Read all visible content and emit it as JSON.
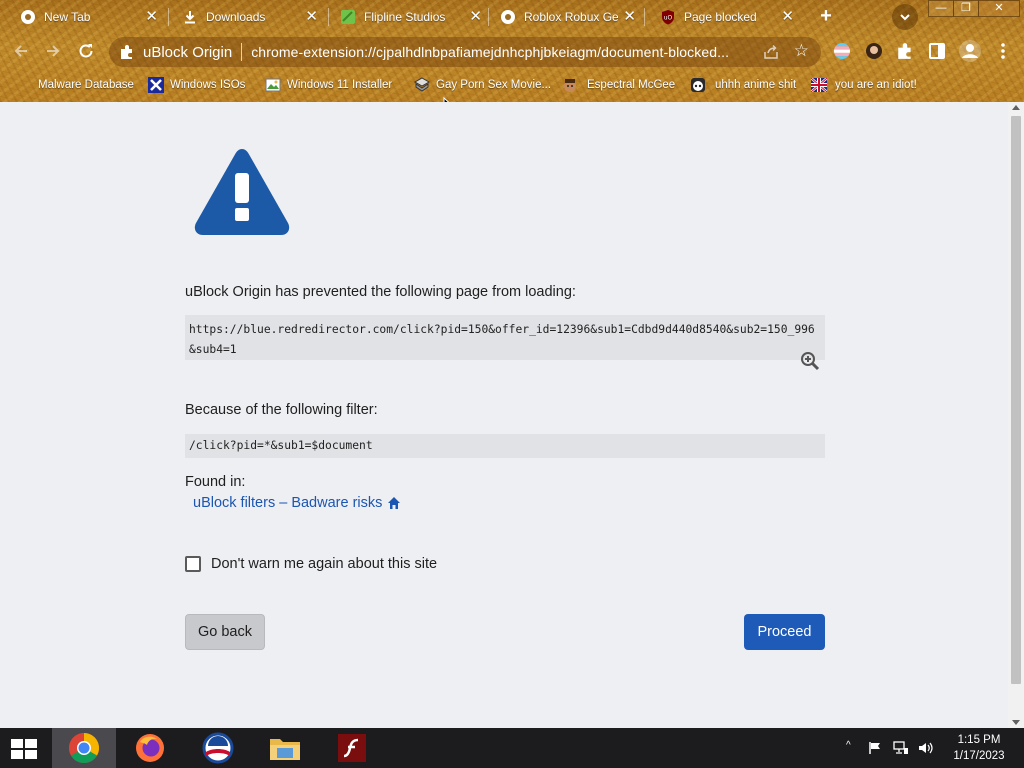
{
  "tabs": [
    {
      "title": "New Tab",
      "favicon": "chrome-icon",
      "close": "✕"
    },
    {
      "title": "Downloads",
      "favicon": "download-icon",
      "close": "✕"
    },
    {
      "title": "Flipline Studios - F",
      "favicon": "flipline-icon",
      "close": "✕"
    },
    {
      "title": "Roblox Robux Gen",
      "favicon": "chrome-icon",
      "close": "✕"
    },
    {
      "title": "Page blocked",
      "favicon": "ublock-icon",
      "close": "✕"
    }
  ],
  "window_controls": {
    "minimize": "—",
    "maximize": "❐",
    "close": "✕"
  },
  "toolbar": {
    "origin_label": "uBlock Origin",
    "url": "chrome-extension://cjpalhdlnbpafiamejdnhcphjbkeiagm/document-blocked..."
  },
  "bookmarks": [
    {
      "label": "Malware Database",
      "icon": "folder-icon"
    },
    {
      "label": "Windows ISOs",
      "icon": "x-icon"
    },
    {
      "label": "Windows 11 Installer",
      "icon": "image-icon"
    },
    {
      "label": "Gay Porn Sex Movie...",
      "icon": "bookmark-icon"
    },
    {
      "label": "Espectral McGee",
      "icon": "avatar-icon"
    },
    {
      "label": "uhhh anime shit",
      "icon": "anime-icon"
    },
    {
      "label": "you are an idiot!",
      "icon": "flag-icon"
    }
  ],
  "page": {
    "intro": "uBlock Origin has prevented the following page from loading:",
    "blocked_url": "https://blue.redredirector.com/click?pid=150&offer_id=12396&sub1=Cdbd9d440d8540&sub2=150_996&sub4=1",
    "because": "Because of the following filter:",
    "filter": "/click?pid=*&sub1=$document",
    "found_in": "Found in:",
    "filter_list": "uBlock filters – Badware risks",
    "dont_warn": "Don't warn me again about this site",
    "go_back": "Go back",
    "proceed": "Proceed"
  },
  "taskbar": {
    "time": "1:15 PM",
    "date": "1/17/2023"
  },
  "colors": {
    "accent_blue": "#1e5bb8",
    "link_blue": "#1b56b0",
    "warning_blue": "#1c5aa8"
  }
}
